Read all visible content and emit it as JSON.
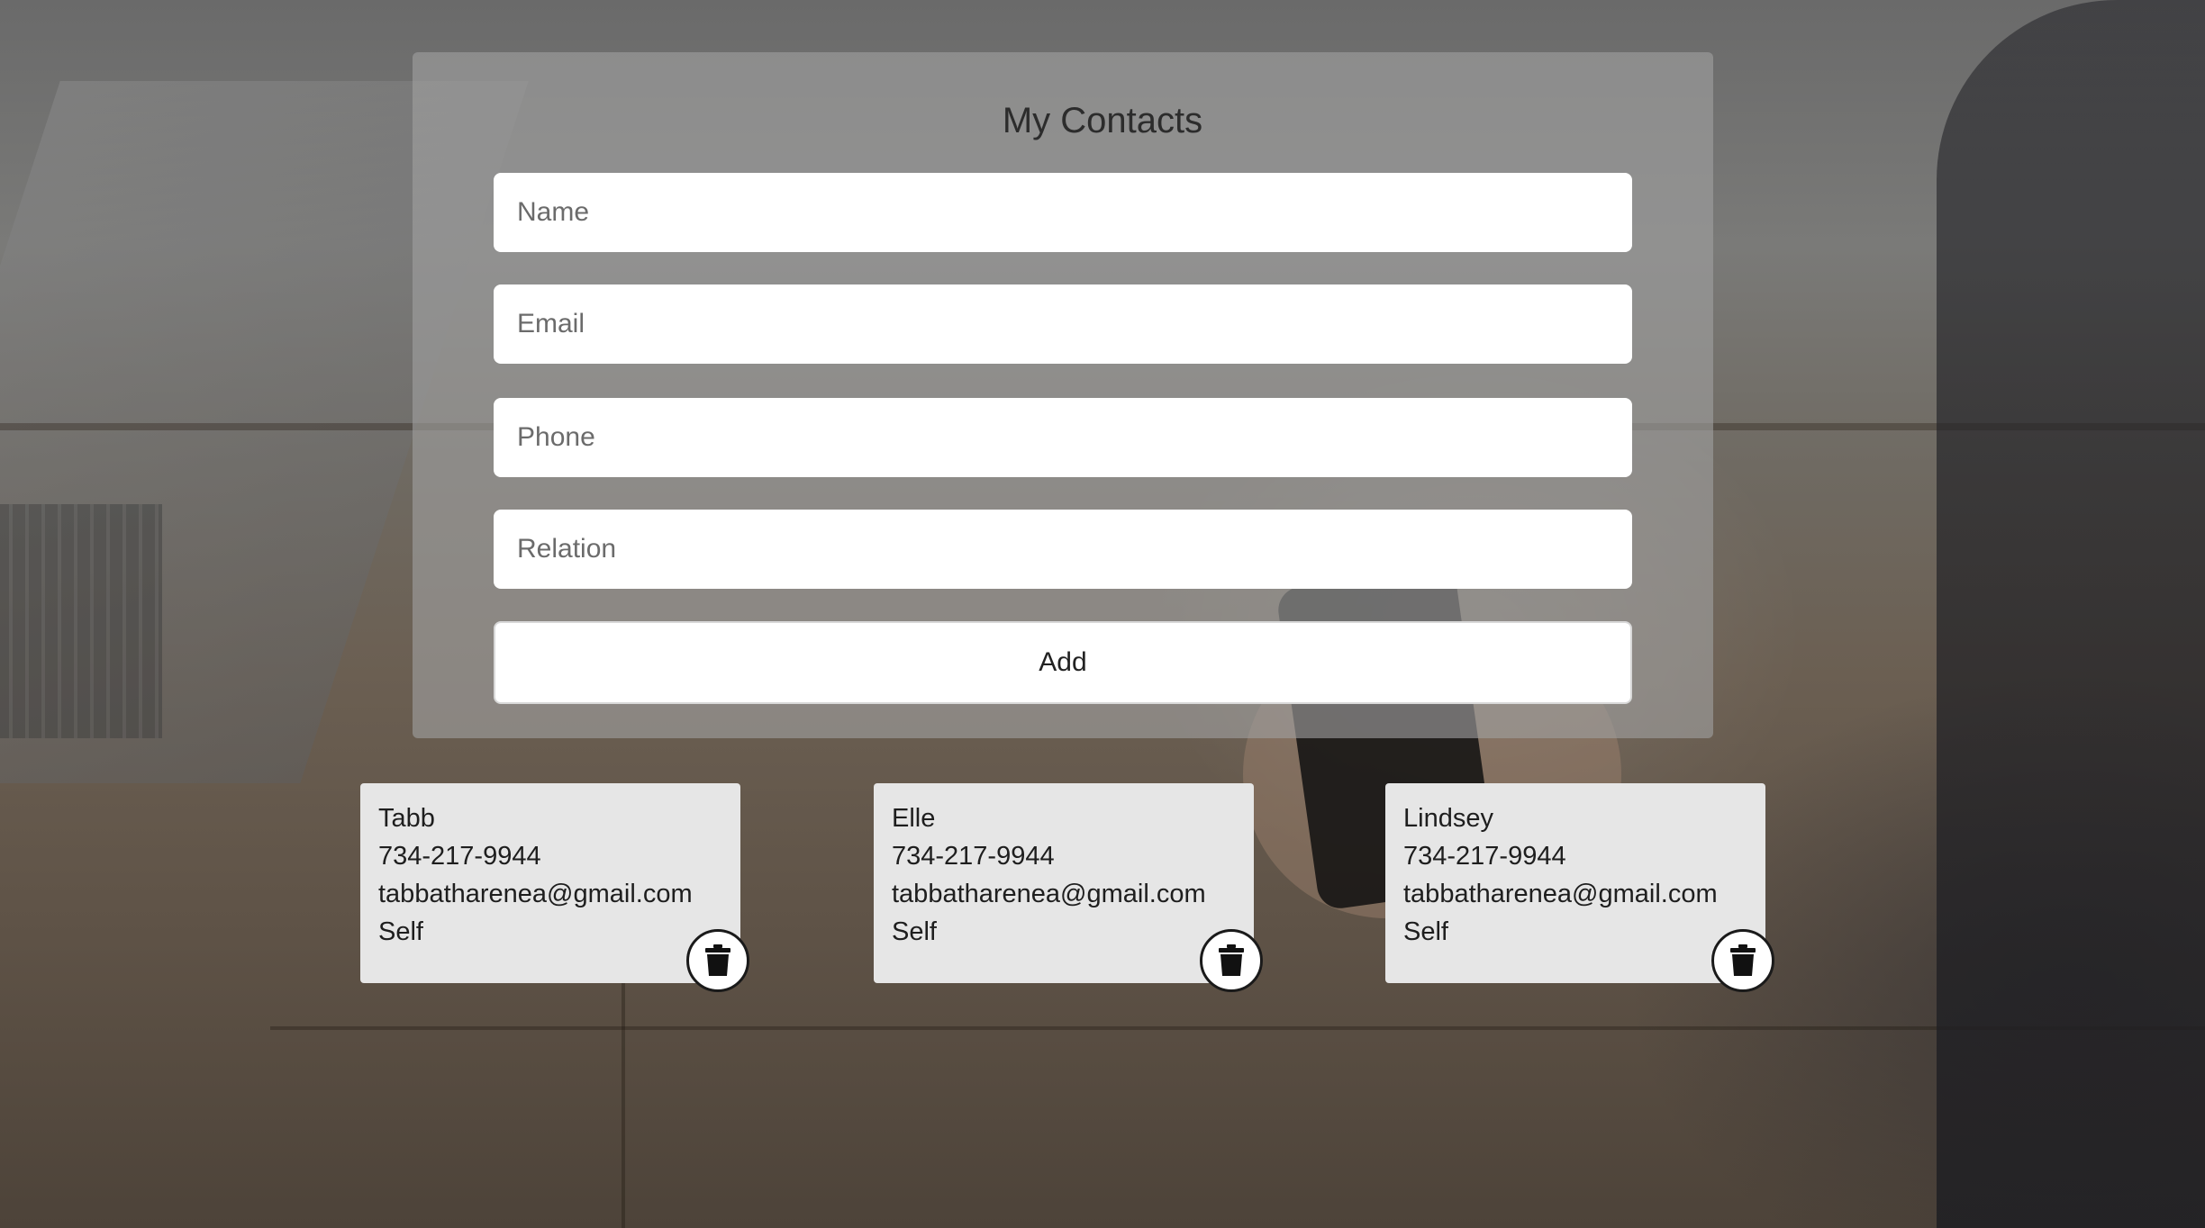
{
  "app": {
    "title": "My Contacts"
  },
  "form": {
    "name_placeholder": "Name",
    "email_placeholder": "Email",
    "phone_placeholder": "Phone",
    "relation_placeholder": "Relation",
    "add_label": "Add"
  },
  "contacts": [
    {
      "name": "Tabb",
      "phone": "734-217-9944",
      "email": "tabbatharenea@gmail.com",
      "relation": "Self",
      "delete_icon": "trash-icon"
    },
    {
      "name": "Elle",
      "phone": "734-217-9944",
      "email": "tabbatharenea@gmail.com",
      "relation": "Self",
      "delete_icon": "trash-icon"
    },
    {
      "name": "Lindsey",
      "phone": "734-217-9944",
      "email": "tabbatharenea@gmail.com",
      "relation": "Self",
      "delete_icon": "trash-icon"
    }
  ],
  "colors": {
    "panel": "#a0a0a0",
    "card": "#e6e6e6",
    "text": "#1e1e1e"
  }
}
